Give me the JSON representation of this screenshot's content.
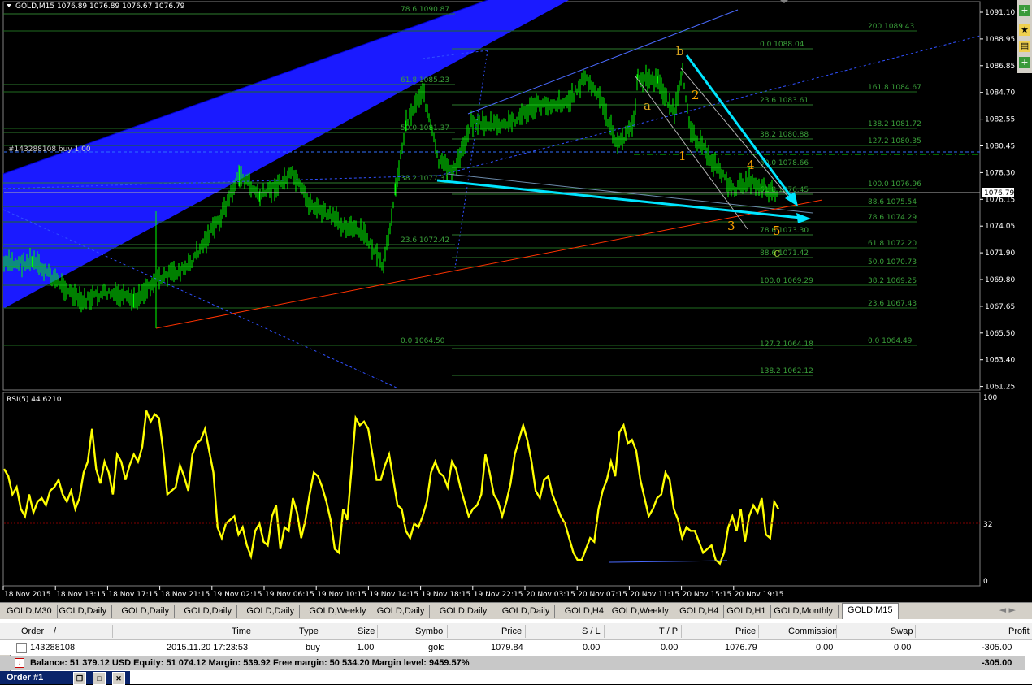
{
  "chart": {
    "header": "GOLD,M15  1076.89 1076.89 1076.67 1076.79",
    "symbol_box_icon": "dropdown-triangle-icon",
    "price_levels": [
      "1091.10",
      "1088.95",
      "1086.85",
      "1084.70",
      "1082.55",
      "1080.45",
      "1078.30",
      "1076.15",
      "1074.05",
      "1071.90",
      "1069.80",
      "1067.65",
      "1065.50",
      "1063.40",
      "1061.25"
    ],
    "current_price": "1076.79",
    "order_line_label": "#143288108 buy 1.00",
    "fib_left": [
      {
        "label": "78.6  1090.87"
      },
      {
        "label": "61.8  1085.23"
      },
      {
        "label": "50.0  1081.37"
      },
      {
        "label": "38.2  1077.31"
      },
      {
        "label": "23.6  1072.42"
      },
      {
        "label": "0.0   1064.50"
      }
    ],
    "fib_mid": [
      {
        "label": "0.0  1088.04"
      },
      {
        "label": "23.6  1083.61"
      },
      {
        "label": "38.2  1080.88"
      },
      {
        "label": "50.0  1078.66"
      },
      {
        "label": "61.8  1076.45"
      },
      {
        "label": "78.6  1073.30"
      },
      {
        "label": "88.6  1071.42"
      },
      {
        "label": "100.0  1069.29"
      },
      {
        "label": "127.2  1064.18"
      },
      {
        "label": "138.2  1062.12"
      }
    ],
    "fib_right": [
      {
        "label": "200  1089.43"
      },
      {
        "label": "161.8  1084.67"
      },
      {
        "label": "138.2  1081.72"
      },
      {
        "label": "127.2  1080.35"
      },
      {
        "label": "100.0  1076.96"
      },
      {
        "label": "88.6  1075.54"
      },
      {
        "label": "78.6  1074.29"
      },
      {
        "label": "61.8  1072.20"
      },
      {
        "label": "50.0  1070.73"
      },
      {
        "label": "38.2  1069.25"
      },
      {
        "label": "23.6  1067.43"
      },
      {
        "label": "0.0  1064.49"
      }
    ],
    "wave_labels": [
      "a",
      "b",
      "c",
      "1",
      "2",
      "3",
      "4",
      "5"
    ],
    "time_labels": [
      "18 Nov 2015",
      "18 Nov 13:15",
      "18 Nov 17:15",
      "18 Nov 21:15",
      "19 Nov 02:15",
      "19 Nov 06:15",
      "19 Nov 10:15",
      "19 Nov 14:15",
      "19 Nov 18:15",
      "19 Nov 22:15",
      "20 Nov 03:15",
      "20 Nov 07:15",
      "20 Nov 11:15",
      "20 Nov 15:15",
      "20 Nov 19:15"
    ],
    "colors": {
      "candle": "#00ff00",
      "grid": "#00a000",
      "fib": "#3f8f3f",
      "channel": "#0000ff",
      "arrow": "#00e5ff",
      "rsi": "#ffff00",
      "trend": "#ff3300",
      "wave": "#daa520"
    }
  },
  "rsi": {
    "label": "RSI(5) 44.6210",
    "levels": [
      "100",
      "32",
      "0"
    ],
    "values": [
      62,
      58,
      48,
      52,
      40,
      36,
      48,
      38,
      44,
      46,
      42,
      50,
      52,
      56,
      48,
      44,
      50,
      40,
      46,
      60,
      66,
      84,
      62,
      54,
      66,
      60,
      48,
      70,
      66,
      56,
      64,
      70,
      66,
      74,
      94,
      88,
      92,
      90,
      72,
      48,
      50,
      52,
      64,
      58,
      50,
      70,
      76,
      78,
      84,
      72,
      60,
      30,
      24,
      32,
      34,
      36,
      26,
      30,
      20,
      14,
      28,
      32,
      22,
      20,
      36,
      42,
      18,
      30,
      28,
      46,
      38,
      24,
      34,
      48,
      60,
      58,
      52,
      44,
      34,
      18,
      16,
      40,
      34,
      62,
      90,
      86,
      88,
      84,
      70,
      56,
      56,
      64,
      70,
      56,
      42,
      40,
      28,
      24,
      32,
      30,
      36,
      44,
      60,
      66,
      60,
      58,
      52,
      66,
      62,
      52,
      44,
      36,
      40,
      42,
      48,
      70,
      60,
      48,
      44,
      36,
      44,
      54,
      70,
      78,
      86,
      78,
      66,
      50,
      46,
      56,
      58,
      48,
      42,
      36,
      32,
      24,
      16,
      12,
      12,
      18,
      24,
      22,
      40,
      50,
      56,
      66,
      58,
      82,
      86,
      76,
      78,
      72,
      56,
      46,
      36,
      40,
      46,
      48,
      60,
      56,
      40,
      34,
      24,
      30,
      28,
      28,
      22,
      16,
      18,
      20,
      12,
      10,
      16,
      30,
      36,
      28,
      40,
      22,
      36,
      42,
      38,
      46,
      26,
      24,
      44,
      40
    ]
  },
  "tabs": [
    "GOLD,M30",
    "GOLD,Daily",
    "GOLD,Daily",
    "GOLD,Daily",
    "GOLD,Daily",
    "GOLD,Weekly",
    "GOLD,Daily",
    "GOLD,Daily",
    "GOLD,Daily",
    "GOLD,H4",
    "GOLD,Weekly",
    "GOLD,H4",
    "GOLD,H1",
    "GOLD,Monthly",
    "GOLD,M15"
  ],
  "terminal": {
    "headers": {
      "order": "Order",
      "sort": "/",
      "time": "Time",
      "type": "Type",
      "size": "Size",
      "symbol": "Symbol",
      "price": "Price",
      "sl": "S / L",
      "tp": "T / P",
      "price2": "Price",
      "commission": "Commission",
      "swap": "Swap",
      "profit": "Profit"
    },
    "row": {
      "order": "143288108",
      "time": "2015.11.20 17:23:53",
      "type": "buy",
      "size": "1.00",
      "symbol": "gold",
      "price": "1079.84",
      "sl": "0.00",
      "tp": "0.00",
      "price2": "1076.79",
      "commission": "0.00",
      "swap": "0.00",
      "profit": "-305.00"
    },
    "balance": "Balance: 51 379.12 USD  Equity: 51 074.12  Margin: 539.92  Free margin: 50 534.20  Margin level: 9459.57%",
    "balance_profit": "-305.00"
  },
  "order_window": {
    "title": "Order #1"
  }
}
